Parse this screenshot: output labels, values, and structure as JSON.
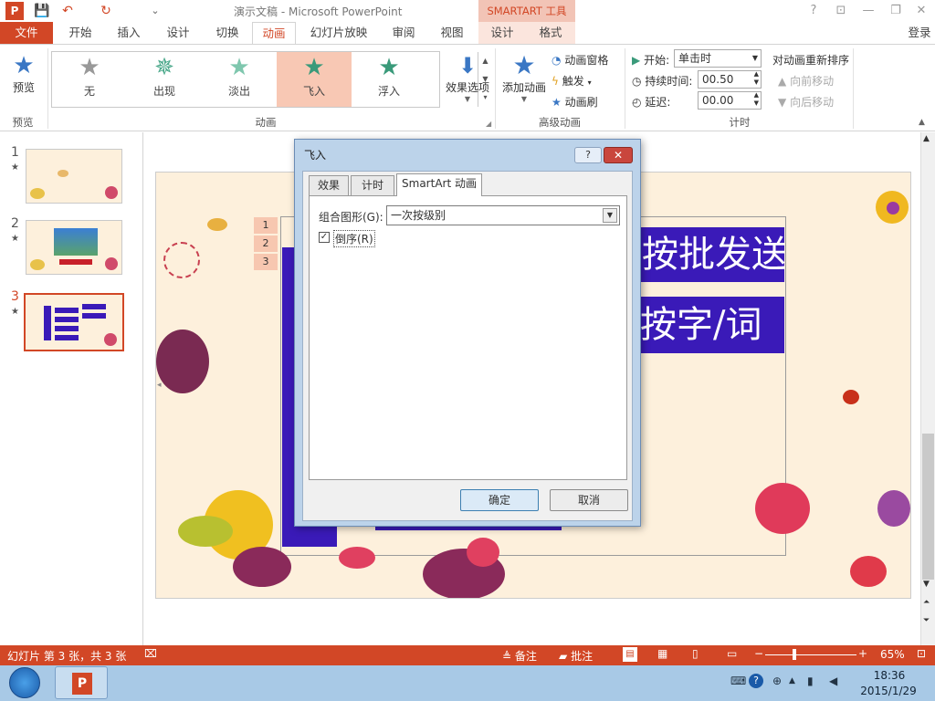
{
  "title_bar": {
    "app_icon": "P",
    "title": "演示文稿 - Microsoft PowerPoint",
    "contextual_tab": "SMARTART 工具",
    "help": "?",
    "controls": {
      "restore_ribbon": "⊡",
      "minimize": "—",
      "maximize": "❐",
      "close": "✕"
    }
  },
  "quick_access": {
    "save": "💾",
    "undo": "↶",
    "redo": "↻",
    "customize": "⌄"
  },
  "tabs": [
    "文件",
    "开始",
    "插入",
    "设计",
    "切换",
    "动画",
    "幻灯片放映",
    "审阅",
    "视图",
    "设计",
    "格式"
  ],
  "login": "登录",
  "ribbon": {
    "preview": {
      "label": "预览",
      "group": "预览"
    },
    "animation_gallery": {
      "items": [
        {
          "label": "无",
          "icon": "none-star-icon"
        },
        {
          "label": "出现",
          "icon": "appear-star-icon"
        },
        {
          "label": "淡出",
          "icon": "fade-star-icon"
        },
        {
          "label": "飞入",
          "icon": "fly-in-star-icon",
          "selected": true
        },
        {
          "label": "浮入",
          "icon": "float-in-star-icon"
        }
      ],
      "group": "动画"
    },
    "effect_options": "效果选项",
    "add_animation": "添加动画",
    "animation_pane": "动画窗格",
    "trigger": "触发",
    "animation_painter": "动画刷",
    "advanced_group": "高级动画",
    "start_label": "开始:",
    "start_value": "单击时",
    "duration_label": "持续时间:",
    "duration_value": "00.50",
    "delay_label": "延迟:",
    "delay_value": "00.00",
    "timing_group": "计时",
    "reorder_title": "对动画重新排序",
    "move_earlier": "向前移动",
    "move_later": "向后移动"
  },
  "slides_pane": {
    "slides": [
      {
        "number": "1",
        "star": "★"
      },
      {
        "number": "2",
        "star": "★"
      },
      {
        "number": "3",
        "star": "★",
        "selected": true
      }
    ]
  },
  "slide": {
    "text_line1": "按批发送",
    "text_line2": "按字/词",
    "anim_tags": [
      "1",
      "2",
      "3"
    ]
  },
  "dialog": {
    "title": "飞入",
    "help": "?",
    "close": "✕",
    "tabs": [
      "效果",
      "计时",
      "SmartArt 动画"
    ],
    "group_label": "组合图形(G):",
    "group_value": "一次按级别",
    "reverse_label": "倒序(R)",
    "reverse_checked": "✓",
    "ok": "确定",
    "cancel": "取消"
  },
  "status_bar": {
    "slide_info": "幻灯片 第 3 张，共 3 张",
    "notes": "备注",
    "comments": "批注",
    "zoom": "65%"
  },
  "taskbar": {
    "time": "18:36",
    "date": "2015/1/29"
  },
  "colors": {
    "accent": "#d24726",
    "smartart_blue": "#3a1ab8",
    "dialog_frame": "#bcd3ea",
    "taskbar": "#a8c9e6"
  }
}
